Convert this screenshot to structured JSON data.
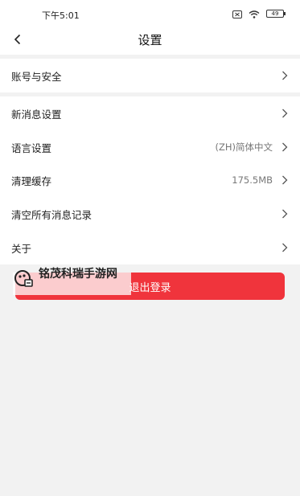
{
  "status_bar": {
    "time": "下午5:01",
    "battery": "49",
    "icons": [
      "sim-off-icon",
      "wifi-icon",
      "battery-icon"
    ]
  },
  "nav": {
    "title": "设置",
    "back_icon": "chevron-left-icon"
  },
  "groups": [
    {
      "items": [
        {
          "label": "账号与安全",
          "value": ""
        }
      ]
    },
    {
      "items": [
        {
          "label": "新消息设置",
          "value": ""
        },
        {
          "label": "语言设置",
          "value": "(ZH)简体中文"
        }
      ]
    },
    {
      "items": [
        {
          "label": "清理缓存",
          "value": "175.5MB"
        },
        {
          "label": "清空所有消息记录",
          "value": ""
        }
      ]
    },
    {
      "items": [
        {
          "label": "关于",
          "value": ""
        }
      ]
    }
  ],
  "logout": {
    "label": "退出登录",
    "color": "#f0343c"
  },
  "watermark": {
    "text": "铭茂科瑞手游网"
  }
}
